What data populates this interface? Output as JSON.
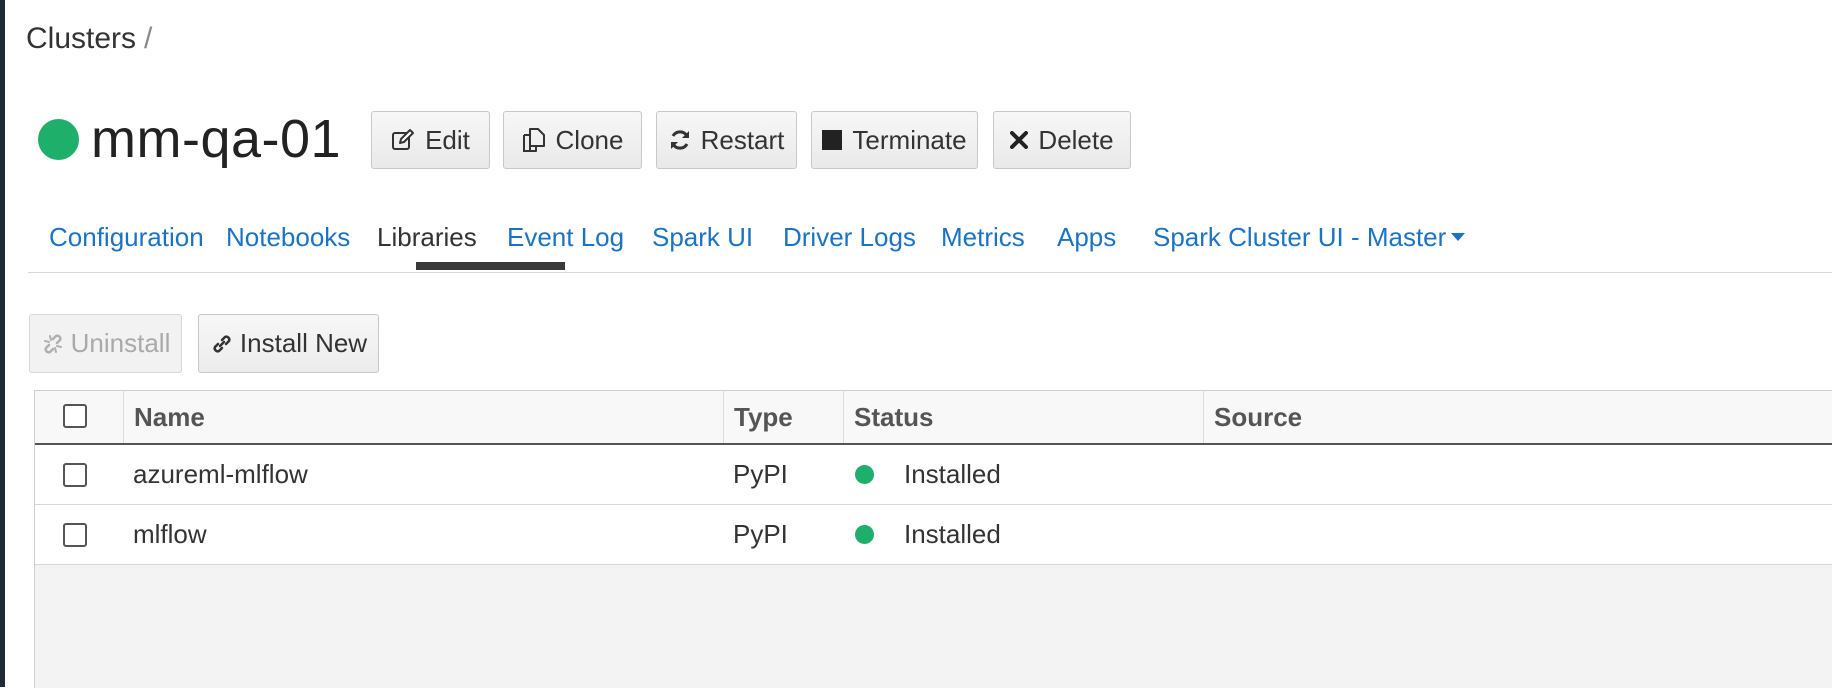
{
  "breadcrumb": {
    "root": "Clusters",
    "separator": "/"
  },
  "cluster": {
    "name": "mm-qa-01",
    "status_color": "#1eb06b",
    "pin_color": "#f0d25a"
  },
  "actions": {
    "edit": "Edit",
    "clone": "Clone",
    "restart": "Restart",
    "terminate": "Terminate",
    "delete": "Delete"
  },
  "tabs": [
    {
      "label": "Configuration"
    },
    {
      "label": "Notebooks"
    },
    {
      "label": "Libraries",
      "active": true
    },
    {
      "label": "Event Log"
    },
    {
      "label": "Spark UI"
    },
    {
      "label": "Driver Logs"
    },
    {
      "label": "Metrics"
    },
    {
      "label": "Apps"
    },
    {
      "label": "Spark Cluster UI - Master"
    }
  ],
  "library_actions": {
    "uninstall": "Uninstall",
    "install_new": "Install New"
  },
  "table": {
    "columns": [
      "Name",
      "Type",
      "Status",
      "Source"
    ],
    "rows": [
      {
        "name": "azureml-mlflow",
        "type": "PyPI",
        "status": "Installed",
        "source": ""
      },
      {
        "name": "mlflow",
        "type": "PyPI",
        "status": "Installed",
        "source": ""
      }
    ]
  },
  "colors": {
    "link": "#1b73c3",
    "installed": "#1eb06b"
  }
}
